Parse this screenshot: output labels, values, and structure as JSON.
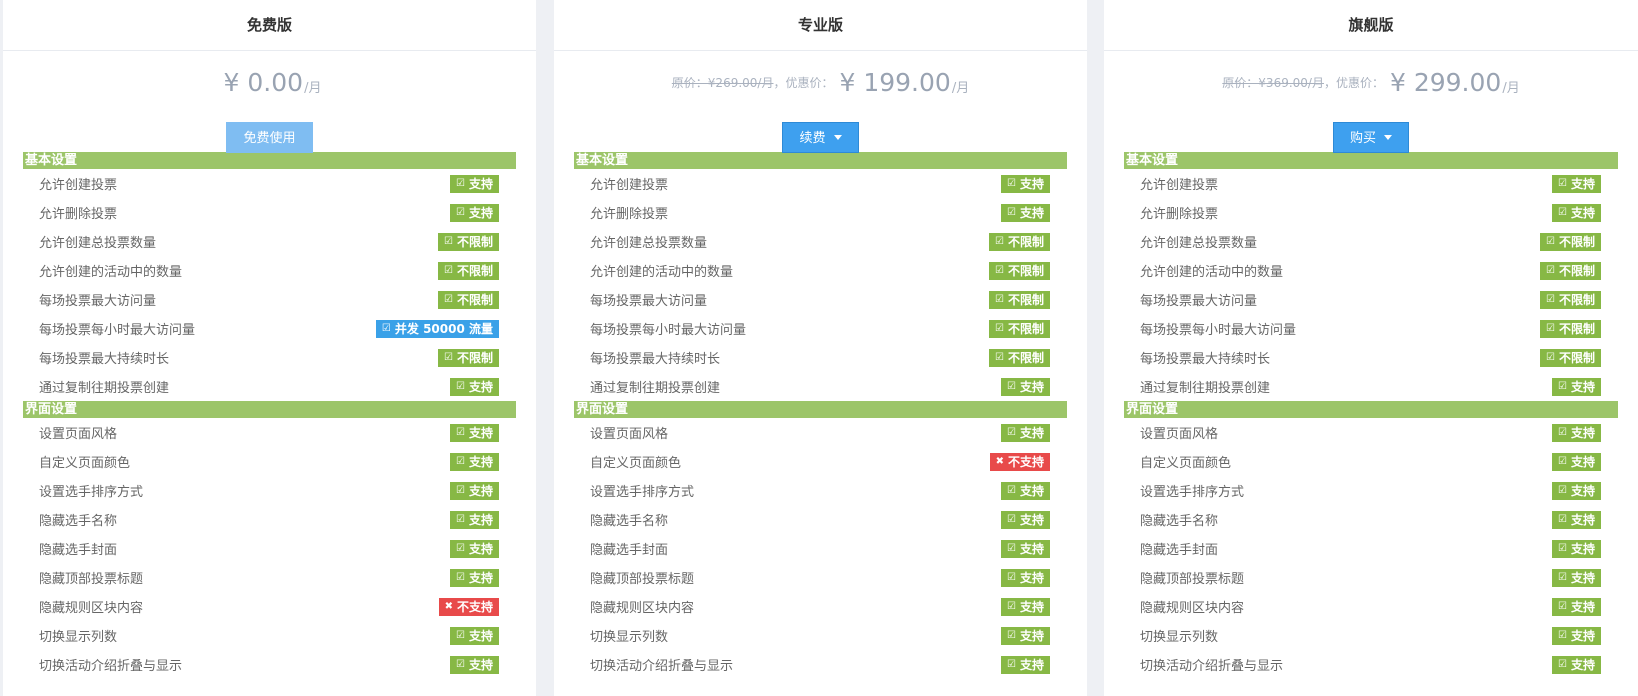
{
  "plans": [
    {
      "title": "免费版",
      "original_price": "",
      "sale_label": "",
      "price": "¥ 0.00",
      "per": "/月",
      "button": "免费使用",
      "sections": [
        {
          "title": "基本设置",
          "features": [
            {
              "label": "允许创建投票",
              "badge": "支持",
              "type": "green",
              "icon": "check-icon"
            },
            {
              "label": "允许删除投票",
              "badge": "支持",
              "type": "green",
              "icon": "check-icon"
            },
            {
              "label": "允许创建总投票数量",
              "badge": "不限制",
              "type": "green",
              "icon": "check-icon"
            },
            {
              "label": "允许创建的活动中的数量",
              "badge": "不限制",
              "type": "green",
              "icon": "check-icon"
            },
            {
              "label": "每场投票最大访问量",
              "badge": "不限制",
              "type": "green",
              "icon": "check-icon"
            },
            {
              "label": "每场投票每小时最大访问量",
              "badge": "并发 50000 流量",
              "type": "blue",
              "icon": "check-icon"
            },
            {
              "label": "每场投票最大持续时长",
              "badge": "不限制",
              "type": "green",
              "icon": "check-icon"
            },
            {
              "label": "通过复制往期投票创建",
              "badge": "支持",
              "type": "green",
              "icon": "check-icon"
            }
          ]
        },
        {
          "title": "界面设置",
          "features": [
            {
              "label": "设置页面风格",
              "badge": "支持",
              "type": "green",
              "icon": "check-icon"
            },
            {
              "label": "自定义页面颜色",
              "badge": "支持",
              "type": "green",
              "icon": "check-icon"
            },
            {
              "label": "设置选手排序方式",
              "badge": "支持",
              "type": "green",
              "icon": "check-icon"
            },
            {
              "label": "隐藏选手名称",
              "badge": "支持",
              "type": "green",
              "icon": "check-icon"
            },
            {
              "label": "隐藏选手封面",
              "badge": "支持",
              "type": "green",
              "icon": "check-icon"
            },
            {
              "label": "隐藏顶部投票标题",
              "badge": "支持",
              "type": "green",
              "icon": "check-icon"
            },
            {
              "label": "隐藏规则区块内容",
              "badge": "不支持",
              "type": "red",
              "icon": "close-icon"
            },
            {
              "label": "切换显示列数",
              "badge": "支持",
              "type": "green",
              "icon": "check-icon"
            },
            {
              "label": "切换活动介绍折叠与显示",
              "badge": "支持",
              "type": "green",
              "icon": "check-icon"
            }
          ]
        }
      ]
    },
    {
      "title": "专业版",
      "original_price": "原价：¥269.00/月",
      "sale_label": "，优惠价：",
      "price": "¥ 199.00",
      "per": "/月",
      "button": "续费",
      "sections": [
        {
          "title": "基本设置",
          "features": [
            {
              "label": "允许创建投票",
              "badge": "支持",
              "type": "green",
              "icon": "check-icon"
            },
            {
              "label": "允许删除投票",
              "badge": "支持",
              "type": "green",
              "icon": "check-icon"
            },
            {
              "label": "允许创建总投票数量",
              "badge": "不限制",
              "type": "green",
              "icon": "check-icon"
            },
            {
              "label": "允许创建的活动中的数量",
              "badge": "不限制",
              "type": "green",
              "icon": "check-icon"
            },
            {
              "label": "每场投票最大访问量",
              "badge": "不限制",
              "type": "green",
              "icon": "check-icon"
            },
            {
              "label": "每场投票每小时最大访问量",
              "badge": "不限制",
              "type": "green",
              "icon": "check-icon"
            },
            {
              "label": "每场投票最大持续时长",
              "badge": "不限制",
              "type": "green",
              "icon": "check-icon"
            },
            {
              "label": "通过复制往期投票创建",
              "badge": "支持",
              "type": "green",
              "icon": "check-icon"
            }
          ]
        },
        {
          "title": "界面设置",
          "features": [
            {
              "label": "设置页面风格",
              "badge": "支持",
              "type": "green",
              "icon": "check-icon"
            },
            {
              "label": "自定义页面颜色",
              "badge": "不支持",
              "type": "red",
              "icon": "close-icon"
            },
            {
              "label": "设置选手排序方式",
              "badge": "支持",
              "type": "green",
              "icon": "check-icon"
            },
            {
              "label": "隐藏选手名称",
              "badge": "支持",
              "type": "green",
              "icon": "check-icon"
            },
            {
              "label": "隐藏选手封面",
              "badge": "支持",
              "type": "green",
              "icon": "check-icon"
            },
            {
              "label": "隐藏顶部投票标题",
              "badge": "支持",
              "type": "green",
              "icon": "check-icon"
            },
            {
              "label": "隐藏规则区块内容",
              "badge": "支持",
              "type": "green",
              "icon": "check-icon"
            },
            {
              "label": "切换显示列数",
              "badge": "支持",
              "type": "green",
              "icon": "check-icon"
            },
            {
              "label": "切换活动介绍折叠与显示",
              "badge": "支持",
              "type": "green",
              "icon": "check-icon"
            }
          ]
        }
      ]
    },
    {
      "title": "旗舰版",
      "original_price": "原价：¥369.00/月",
      "sale_label": "，优惠价：",
      "price": "¥ 299.00",
      "per": "/月",
      "button": "购买",
      "sections": [
        {
          "title": "基本设置",
          "features": [
            {
              "label": "允许创建投票",
              "badge": "支持",
              "type": "green",
              "icon": "check-icon"
            },
            {
              "label": "允许删除投票",
              "badge": "支持",
              "type": "green",
              "icon": "check-icon"
            },
            {
              "label": "允许创建总投票数量",
              "badge": "不限制",
              "type": "green",
              "icon": "check-icon"
            },
            {
              "label": "允许创建的活动中的数量",
              "badge": "不限制",
              "type": "green",
              "icon": "check-icon"
            },
            {
              "label": "每场投票最大访问量",
              "badge": "不限制",
              "type": "green",
              "icon": "check-icon"
            },
            {
              "label": "每场投票每小时最大访问量",
              "badge": "不限制",
              "type": "green",
              "icon": "check-icon"
            },
            {
              "label": "每场投票最大持续时长",
              "badge": "不限制",
              "type": "green",
              "icon": "check-icon"
            },
            {
              "label": "通过复制往期投票创建",
              "badge": "支持",
              "type": "green",
              "icon": "check-icon"
            }
          ]
        },
        {
          "title": "界面设置",
          "features": [
            {
              "label": "设置页面风格",
              "badge": "支持",
              "type": "green",
              "icon": "check-icon"
            },
            {
              "label": "自定义页面颜色",
              "badge": "支持",
              "type": "green",
              "icon": "check-icon"
            },
            {
              "label": "设置选手排序方式",
              "badge": "支持",
              "type": "green",
              "icon": "check-icon"
            },
            {
              "label": "隐藏选手名称",
              "badge": "支持",
              "type": "green",
              "icon": "check-icon"
            },
            {
              "label": "隐藏选手封面",
              "badge": "支持",
              "type": "green",
              "icon": "check-icon"
            },
            {
              "label": "隐藏顶部投票标题",
              "badge": "支持",
              "type": "green",
              "icon": "check-icon"
            },
            {
              "label": "隐藏规则区块内容",
              "badge": "支持",
              "type": "green",
              "icon": "check-icon"
            },
            {
              "label": "切换显示列数",
              "badge": "支持",
              "type": "green",
              "icon": "check-icon"
            },
            {
              "label": "切换活动介绍折叠与显示",
              "badge": "支持",
              "type": "green",
              "icon": "check-icon"
            }
          ]
        }
      ]
    }
  ],
  "colors": {
    "section_green": "#9cc569",
    "badge_green": "#87b845",
    "badge_blue": "#3aa1e8",
    "badge_red": "#e84a4a",
    "button_blue": "#3ea0ef",
    "button_free": "#7fbdf2"
  }
}
